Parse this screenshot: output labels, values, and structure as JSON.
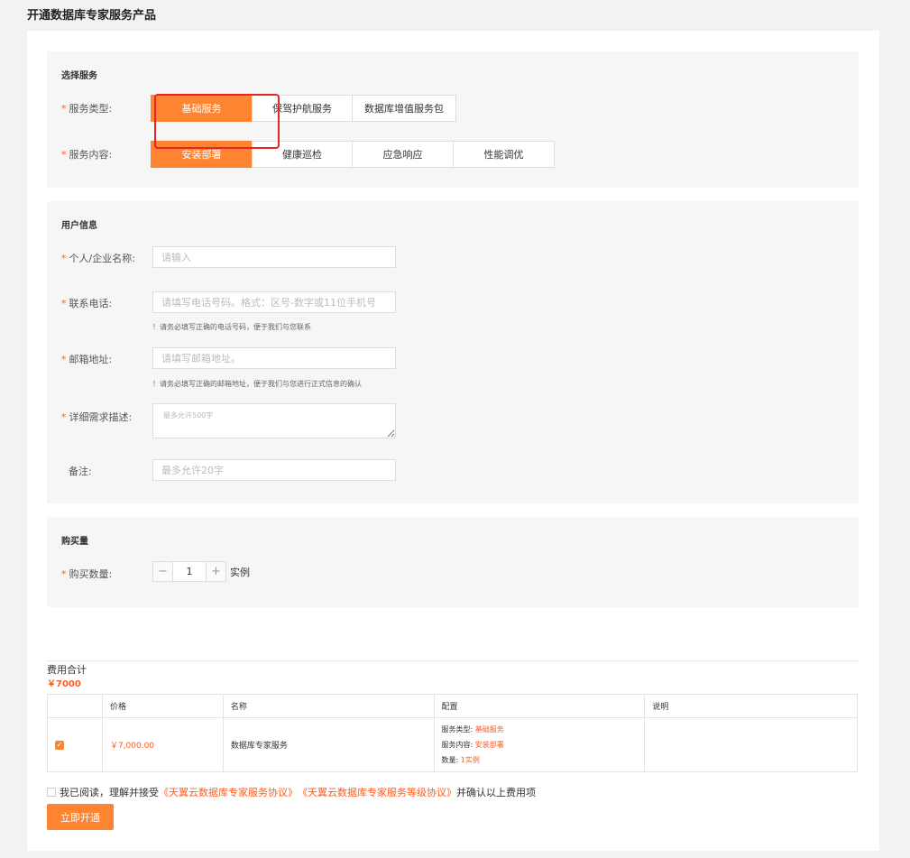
{
  "page_title": "开通数据库专家服务产品",
  "select_service": {
    "title": "选择服务",
    "type_label": "服务类型:",
    "type_options": [
      "基础服务",
      "保驾护航服务",
      "数据库增值服务包"
    ],
    "type_selected": "基础服务",
    "content_label": "服务内容:",
    "content_options": [
      "安装部署",
      "健康巡检",
      "应急响应",
      "性能调优"
    ],
    "content_selected": "安装部署"
  },
  "user_info": {
    "title": "用户信息",
    "name_label": "个人/企业名称:",
    "name_placeholder": "请输入",
    "phone_label": "联系电话:",
    "phone_placeholder": "请填写电话号码。格式：区号-数字或11位手机号",
    "phone_hint": "！请务必填写正确的电话号码，便于我们与您联系",
    "email_label": "邮箱地址:",
    "email_placeholder": "请填写邮箱地址。",
    "email_hint": "！请务必填写正确的邮箱地址，便于我们与您进行正式信息的确认",
    "desc_label": "详细需求描述:",
    "desc_placeholder": "最多允许500字",
    "remark_label": "备注:",
    "remark_placeholder": "最多允许20字"
  },
  "purchase": {
    "title": "购买量",
    "qty_label": "购买数量:",
    "minus": "−",
    "plus": "+",
    "qty": "1",
    "unit": "实例"
  },
  "cost": {
    "label": "费用合计",
    "total": "￥7000",
    "headers": [
      "",
      "价格",
      "名称",
      "配置",
      "说明"
    ],
    "row": {
      "price": "￥7,000.00",
      "name": "数据库专家服务",
      "config_type_label": "服务类型:",
      "config_type_value": "基础服务",
      "config_content_label": "服务内容:",
      "config_content_value": "安装部署",
      "config_qty_label": "数量:",
      "config_qty_value": "1实例",
      "note": ""
    }
  },
  "agreement": {
    "prefix": "我已阅读，理解并接受",
    "link1": "《天翼云数据库专家服务协议》",
    "link2": "《天翼云数据库专家服务等级协议》",
    "suffix": "并确认以上费用项"
  },
  "submit_label": "立即开通",
  "colors": {
    "accent": "#ff8432",
    "highlight": "#e82323"
  }
}
